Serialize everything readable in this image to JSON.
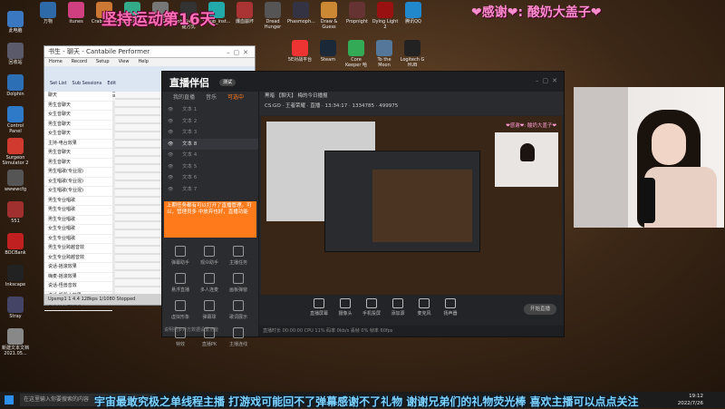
{
  "overlay": {
    "left_banner": "坚持运动第16天",
    "right_banner": "❤感谢❤: 酸奶大盖子❤",
    "bottom_marquee": "宇宙最敢究极之单线程主播 打游戏可能回不了弹幕感谢不了礼物 谢谢兄弟们的礼物荧光棒 喜欢主播可以点点关注"
  },
  "desktop_icons": [
    {
      "label": "此电脑",
      "color": "#3a78c2"
    },
    {
      "label": "回收站",
      "color": "#5a5a6a"
    },
    {
      "label": "Dolphin",
      "color": "#2c6fb5"
    },
    {
      "label": "Control Panel",
      "color": "#2f7ac8"
    },
    {
      "label": "Surgeon Simulator 2",
      "color": "#d13a2e"
    },
    {
      "label": "wwwwcfg",
      "color": "#555"
    },
    {
      "label": "551",
      "color": "#a03030"
    },
    {
      "label": "BOCBank",
      "color": "#c02020"
    },
    {
      "label": "Inkscape",
      "color": "#222"
    },
    {
      "label": "Stray",
      "color": "#446"
    },
    {
      "label": "新建文本文档 2021.05...",
      "color": "#888"
    }
  ],
  "top_icons": [
    {
      "label": "万物",
      "color": "#2f6aa8"
    },
    {
      "label": "itunes",
      "color": "#d04080"
    },
    {
      "label": "Crab Game",
      "color": "#c73",
      "x": ""
    },
    {
      "label": "Experience",
      "color": "#3a8"
    },
    {
      "label": "2021111...",
      "color": "#777"
    },
    {
      "label": "obs64 - 快捷方式",
      "color": "#333"
    },
    {
      "label": "lghub_inst...",
      "color": "#2aa"
    },
    {
      "label": "爆血崩坏",
      "color": "#a33"
    },
    {
      "label": "Dread Hunger",
      "color": "#555"
    },
    {
      "label": "Phasmoph...",
      "color": "#334"
    },
    {
      "label": "Draw & Guess",
      "color": "#c83"
    },
    {
      "label": "Propnight",
      "color": "#633"
    },
    {
      "label": "Dying Light 2",
      "color": "#911"
    },
    {
      "label": "腾讯QQ",
      "color": "#28c"
    }
  ],
  "top_icons_row2": [
    {
      "label": "5E对战平台",
      "color": "#e33"
    },
    {
      "label": "Steam",
      "color": "#1b2838"
    },
    {
      "label": "Core Keeper 哈",
      "color": "#3a5"
    },
    {
      "label": "To the Moon",
      "color": "#579"
    },
    {
      "label": "Logitech G HUB",
      "color": "#222"
    }
  ],
  "cantabile": {
    "title": "书生 - 聊天 - Cantabile Performer",
    "menu": [
      "Home",
      "Record",
      "Setup",
      "View",
      "Help"
    ],
    "ribbon_labels": [
      "Set List",
      "Sub Sessions",
      "Edit"
    ],
    "tabs": [
      "Sessions",
      "Racks",
      "Routes",
      "Media"
    ],
    "items": [
      "聊天",
      "男生音聊天",
      "女生音聊天",
      "男生音聊天",
      "女生音聊天",
      "主持-电台效果",
      "男生音聊天",
      "男生音聊天",
      "男生唱歌(专业混)",
      "女生唱歌(专业混)",
      "女生唱歌(专业混)",
      "男生专业唱歌",
      "男生专业唱歌",
      "男生专业唱歌",
      "女生专业唱歌",
      "女生专业唱歌",
      "男生专业跨越音效",
      "女生专业跨越音效",
      "说话-摇滚效果",
      "嗨麦-摇滚效果",
      "说话-怪兽音效",
      "说话-机器人效果",
      "专业男主播纯人声"
    ],
    "status": [
      "Upsmp1 1",
      "4.4",
      "128kps",
      "1/1080",
      "Stopped"
    ]
  },
  "live_app": {
    "logo": "直播伴侣",
    "badge": "测试",
    "left_tabs": [
      "我的直播",
      "音乐",
      "可选中"
    ],
    "active_left_tab": "可选中",
    "sources": [
      "文本 1",
      "文本 2",
      "文本 3",
      "文本 8",
      "文本 4",
      "文本 5",
      "文本 6",
      "文本 7"
    ],
    "active_source": "文本 8",
    "notice": "上期任务都有可以打开了直播管理。可以，管理员多 中放弃也好，直播功能",
    "tools": [
      "弹幕助手",
      "观众助手",
      "主播任务",
      "悬浮直播",
      "多人连麦",
      "画板弹窗",
      "虚拟形象",
      "弹幕球",
      "歌词展示",
      "特效",
      "直播PK",
      "主播连线"
    ],
    "footer_note": "说明把多对方数据设置功能",
    "room_title": "黑暗 【聊天】 梅的今日播报",
    "room_sub": "CS:GO · 王者荣耀 · 直播 · 13:34:17 · 1334785 · 499975",
    "preview_chat": "❤感谢❤: 酸奶大盖子❤",
    "controls": [
      "直播屏幕",
      "摄像头",
      "手机投屏",
      "添加源",
      "麦克风",
      "扬声器"
    ],
    "start_button": "开始直播",
    "status": "直播时长 00:00:00   CPU 11%   码率 0kb/s   丢帧 0%   帧率 60fps"
  },
  "taskbar": {
    "search_placeholder": "在这里输入你要搜索的内容",
    "time": "19:12",
    "date": "2022/7/26"
  }
}
